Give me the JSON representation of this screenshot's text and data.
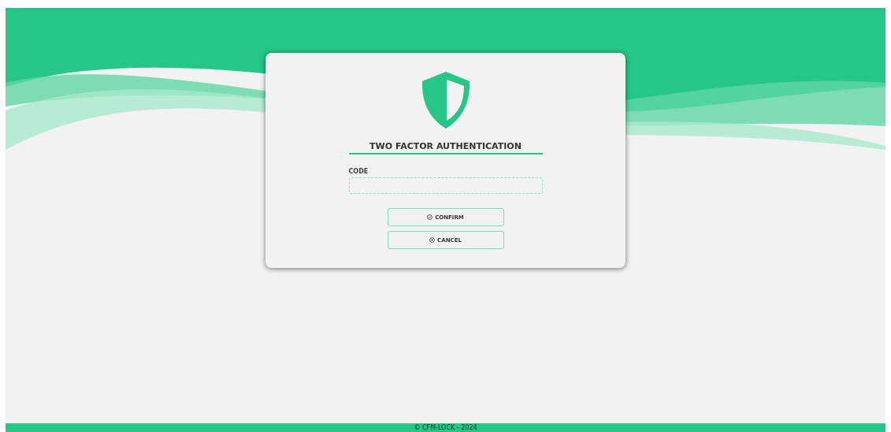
{
  "title": "TWO FACTOR AUTHENTICATION",
  "code_field": {
    "label": "CODE"
  },
  "buttons": [
    {
      "kind": "confirm",
      "label": "CONFIRM"
    },
    {
      "kind": "cancel",
      "label": "CANCEL"
    }
  ],
  "footer": "© CFM-LOCK - 2024"
}
